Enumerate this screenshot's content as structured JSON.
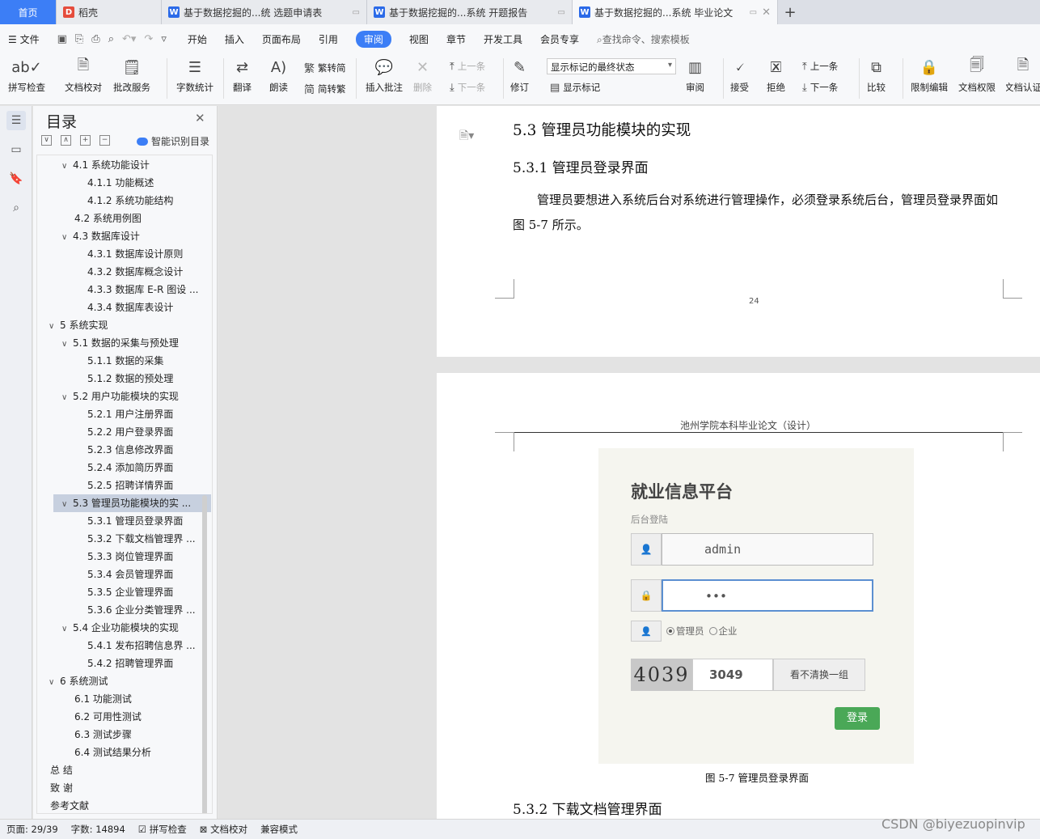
{
  "tabs": {
    "home": "首页",
    "dock": "稻壳",
    "doc1": "基于数据挖掘的...统 选题申请表",
    "doc2": "基于数据挖掘的...系统 开题报告",
    "doc3": "基于数据挖掘的...系统 毕业论文"
  },
  "menu": {
    "file": "文件",
    "items": [
      "开始",
      "插入",
      "页面布局",
      "引用",
      "审阅",
      "视图",
      "章节",
      "开发工具",
      "会员专享"
    ],
    "search": "查找命令、搜索模板"
  },
  "ribbon": {
    "spell": "拼写检查",
    "proofread": "文档校对",
    "review_service": "批改服务",
    "wordcount": "字数统计",
    "translate": "翻译",
    "read": "朗读",
    "trad": "繁转简",
    "simp": "简转繁",
    "insert_comment": "插入批注",
    "delete": "删除",
    "prev": "上一条",
    "next": "下一条",
    "track": "修订",
    "markup_state": "显示标记的最终状态",
    "show_markup": "显示标记",
    "review": "审阅",
    "accept": "接受",
    "reject": "拒绝",
    "prev2": "上一条",
    "next2": "下一条",
    "compare": "比较",
    "restrict": "限制编辑",
    "permission": "文档权限",
    "doc_auth": "文档认证"
  },
  "toc": {
    "title": "目录",
    "smart": "智能识别目录",
    "items": [
      "4.1 系统功能设计",
      "4.1.1 功能概述",
      "4.1.2 系统功能结构",
      "4.2 系统用例图",
      "4.3 数据库设计",
      "4.3.1 数据库设计原则",
      "4.3.2 数据库概念设计",
      "4.3.3 数据库 E-R 图设 ...",
      "4.3.4 数据库表设计",
      "5 系统实现",
      "5.1 数据的采集与预处理",
      "5.1.1 数据的采集",
      "5.1.2 数据的预处理",
      "5.2 用户功能模块的实现",
      "5.2.1 用户注册界面",
      "5.2.2 用户登录界面",
      "5.2.3 信息修改界面",
      "5.2.4 添加简历界面",
      "5.2.5 招聘详情界面",
      "5.3 管理员功能模块的实 ...",
      "5.3.1 管理员登录界面",
      "5.3.2 下载文档管理界 ...",
      "5.3.3 岗位管理界面",
      "5.3.4 会员管理界面",
      "5.3.5 企业管理界面",
      "5.3.6 企业分类管理界 ...",
      "5.4 企业功能模块的实现",
      "5.4.1 发布招聘信息界 ...",
      "5.4.2 招聘管理界面",
      "6 系统测试",
      "6.1 功能测试",
      "6.2 可用性测试",
      "6.3 测试步骤",
      "6.4 测试结果分析",
      "总 结",
      "致 谢",
      "参考文献"
    ]
  },
  "page1": {
    "h_53": "5.3 管理员功能模块的实现",
    "h_531": "5.3.1 管理员登录界面",
    "para": "管理员要想进入系统后台对系统进行管理操作，必须登录系统后台，管理员登录界面如图 5-7 所示。",
    "page_num": "24"
  },
  "page2": {
    "header": "池州学院本科毕业论文（设计）",
    "login": {
      "title": "就业信息平台",
      "subtitle": "后台登陆",
      "username": "admin",
      "password": "•••",
      "role_admin": "管理员",
      "role_company": "企业",
      "captcha_img": "4039",
      "captcha_input": "3049",
      "captcha_refresh": "看不清换一组",
      "login_btn": "登录"
    },
    "fig_caption": "图 5-7 管理员登录界面",
    "h_532": "5.3.2 下载文档管理界面"
  },
  "status": {
    "page": "页面: 29/39",
    "words": "字数: 14894",
    "spell": "拼写检查",
    "proof": "文档校对",
    "compat": "兼容模式"
  },
  "watermark": "CSDN @biyezuopinvip"
}
